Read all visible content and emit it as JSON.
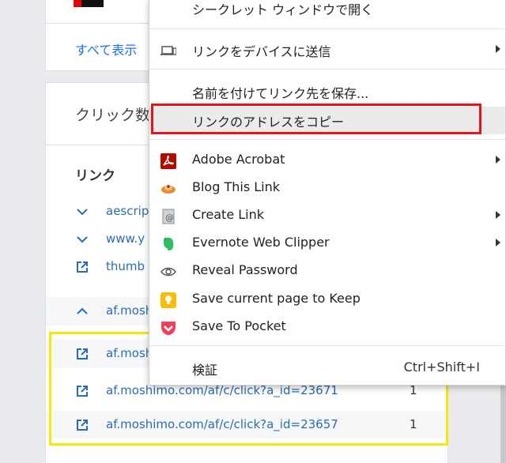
{
  "background": {
    "show_all_link": "すべて表示",
    "click_section_title": "クリック数",
    "links_heading": "リンク",
    "rows": [
      {
        "type": "expand",
        "label": "aescripts"
      },
      {
        "type": "expand",
        "label": "www.y"
      },
      {
        "type": "external",
        "label": "thumb"
      },
      {
        "type": "collapse",
        "label": "af.mosh"
      },
      {
        "type": "external",
        "label": "af.mosh",
        "count": ""
      },
      {
        "type": "external",
        "label": "af.moshimo.com/af/c/click?a_id=23671",
        "count": "1"
      },
      {
        "type": "external",
        "label": "af.moshimo.com/af/c/click?a_id=23657",
        "count": "1"
      }
    ]
  },
  "context_menu": {
    "items": [
      {
        "label": "シークレット ウィンドウで開く"
      },
      {
        "label": "リンクをデバイスに送信",
        "icon": "devices-icon",
        "submenu": true
      },
      {
        "label": "名前を付けてリンク先を保存..."
      },
      {
        "label": "リンクのアドレスをコピー",
        "highlighted": true
      },
      {
        "label": "Adobe Acrobat",
        "icon": "adobe-acrobat-icon",
        "submenu": true
      },
      {
        "label": "Blog This Link",
        "icon": "blog-this-icon"
      },
      {
        "label": "Create Link",
        "icon": "create-link-icon",
        "submenu": true
      },
      {
        "label": "Evernote Web Clipper",
        "icon": "evernote-icon",
        "submenu": true
      },
      {
        "label": "Reveal Password",
        "icon": "eye-icon"
      },
      {
        "label": "Save current page to Keep",
        "icon": "keep-icon"
      },
      {
        "label": "Save To Pocket",
        "icon": "pocket-icon"
      },
      {
        "label": "検証",
        "shortcut": "Ctrl+Shift+I"
      }
    ]
  },
  "colors": {
    "highlight_yellow": "#f4e90b",
    "highlight_red": "#e8121b",
    "link_blue": "#1a73e8",
    "adobe_red": "#b30b00",
    "evernote_green": "#2dbe60",
    "keep_yellow": "#fbbc04",
    "pocket_red": "#ef4056"
  }
}
